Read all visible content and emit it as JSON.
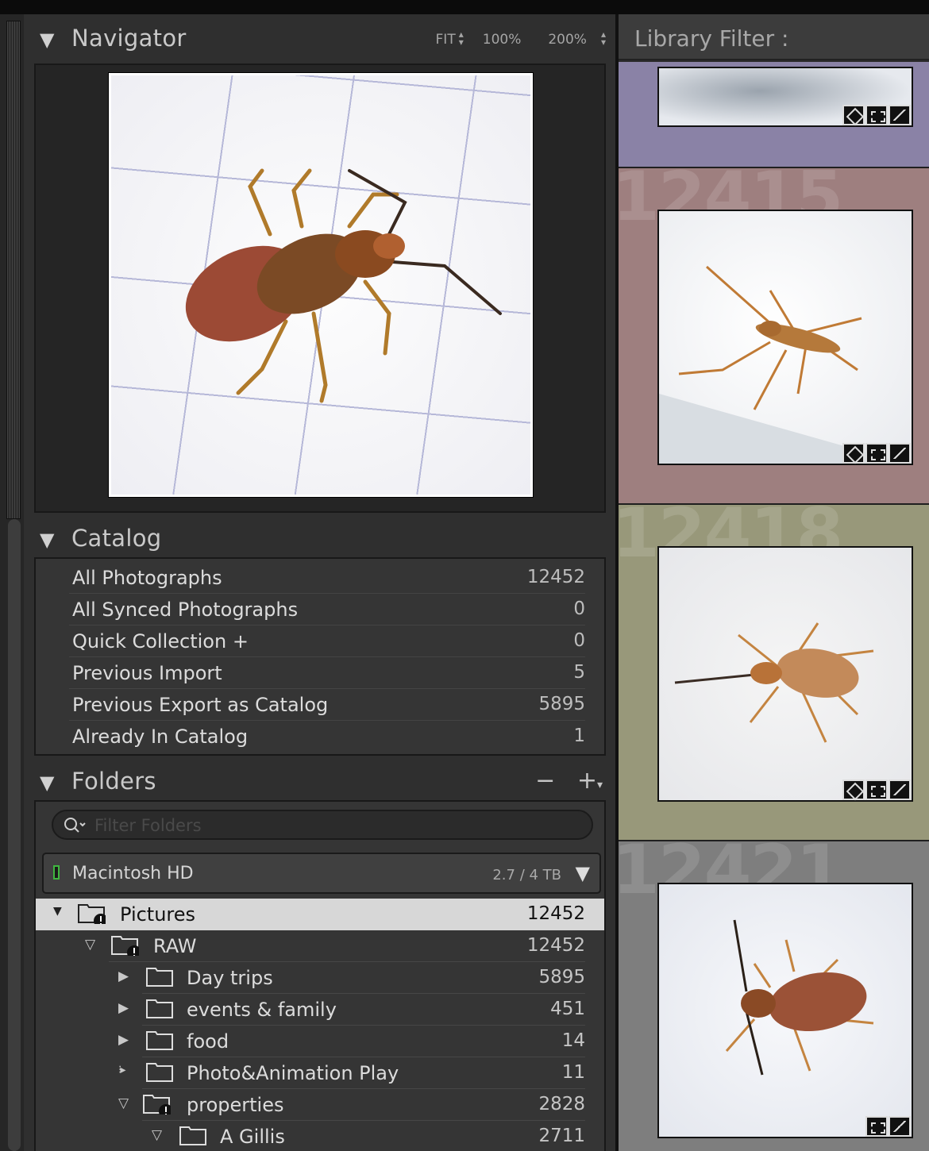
{
  "navigator": {
    "title": "Navigator",
    "zoom_fit": "FIT",
    "zoom_100": "100%",
    "zoom_200": "200%"
  },
  "catalog": {
    "title": "Catalog",
    "items": [
      {
        "label": "All Photographs",
        "count": "12452"
      },
      {
        "label": "All Synced Photographs",
        "count": "0"
      },
      {
        "label": "Quick Collection  +",
        "count": "0"
      },
      {
        "label": "Previous Import",
        "count": "5"
      },
      {
        "label": "Previous Export as Catalog",
        "count": "5895"
      },
      {
        "label": "Already In Catalog",
        "count": "1"
      }
    ]
  },
  "folders": {
    "title": "Folders",
    "filter_placeholder": "Filter Folders",
    "volume": {
      "name": "Macintosh HD",
      "capacity": "2.7 / 4 TB"
    },
    "items": [
      {
        "label": "Pictures",
        "count": "12452"
      },
      {
        "label": "RAW",
        "count": "12452"
      },
      {
        "label": "Day trips",
        "count": "5895"
      },
      {
        "label": "events & family",
        "count": "451"
      },
      {
        "label": "food",
        "count": "14"
      },
      {
        "label": "Photo&Animation Play",
        "count": "11"
      },
      {
        "label": "properties",
        "count": "2828"
      },
      {
        "label": "A Gillis",
        "count": "2711"
      }
    ]
  },
  "library_filter": {
    "title": "Library Filter :"
  },
  "grid": {
    "cells": [
      {
        "index": "",
        "color": "#8a82a6"
      },
      {
        "index": "12415",
        "color": "#9e7f7f"
      },
      {
        "index": "12418",
        "color": "#98987a"
      },
      {
        "index": "12421",
        "color": "#7e7e7e"
      }
    ]
  },
  "icons": [
    "disclosure-triangle-icon",
    "search-icon",
    "folder-icon",
    "warning-badge-icon",
    "metadata-badge-icon",
    "crop-badge-icon",
    "develop-badge-icon"
  ]
}
